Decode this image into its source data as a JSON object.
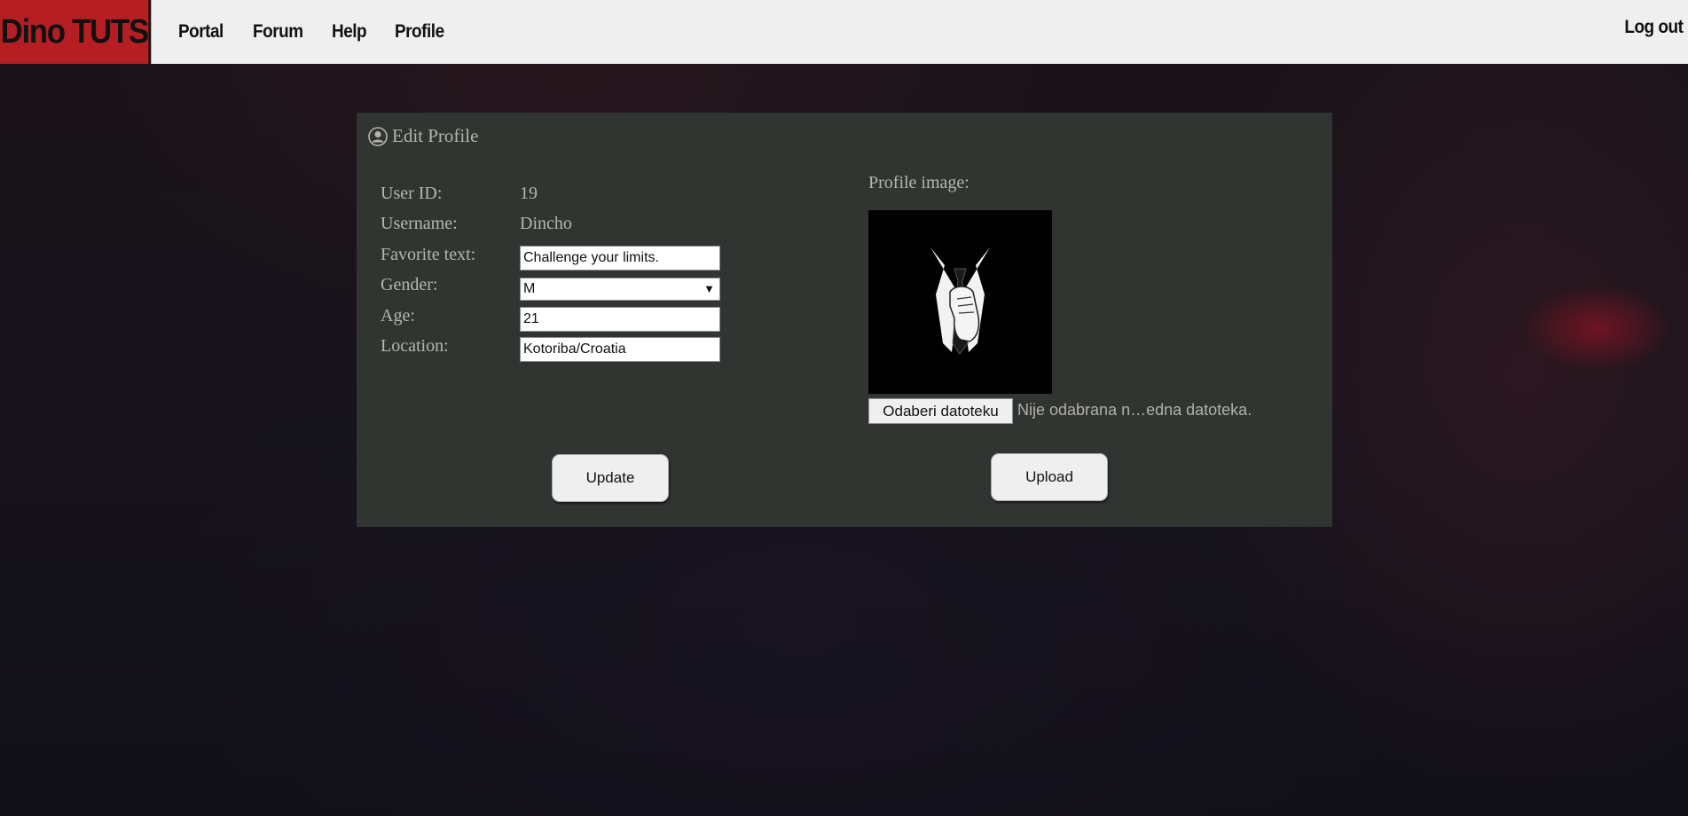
{
  "brand": "Dino TUTS",
  "nav": {
    "items": [
      "Portal",
      "Forum",
      "Help",
      "Profile"
    ],
    "logout": "Log out"
  },
  "panel": {
    "title": "Edit Profile",
    "title_icon": "user-circle-icon",
    "fields": {
      "user_id": {
        "label": "User ID:",
        "value": "19"
      },
      "username": {
        "label": "Username:",
        "value": "Dincho"
      },
      "favorite_text": {
        "label": "Favorite text:",
        "value": "Challenge your limits."
      },
      "gender": {
        "label": "Gender:",
        "value": "M"
      },
      "age": {
        "label": "Age:",
        "value": "21"
      },
      "location": {
        "label": "Location:",
        "value": "Kotoriba/Croatia"
      }
    },
    "profile_image_label": "Profile image:",
    "file_button": "Odaberi datoteku",
    "file_status": "Nije odabrana n…edna datoteka.",
    "update_button": "Update",
    "upload_button": "Upload"
  },
  "colors": {
    "brand_red": "#b51e23",
    "topbar": "#efefef",
    "panel": "#313532",
    "panel_text": "#b6b6ad"
  }
}
